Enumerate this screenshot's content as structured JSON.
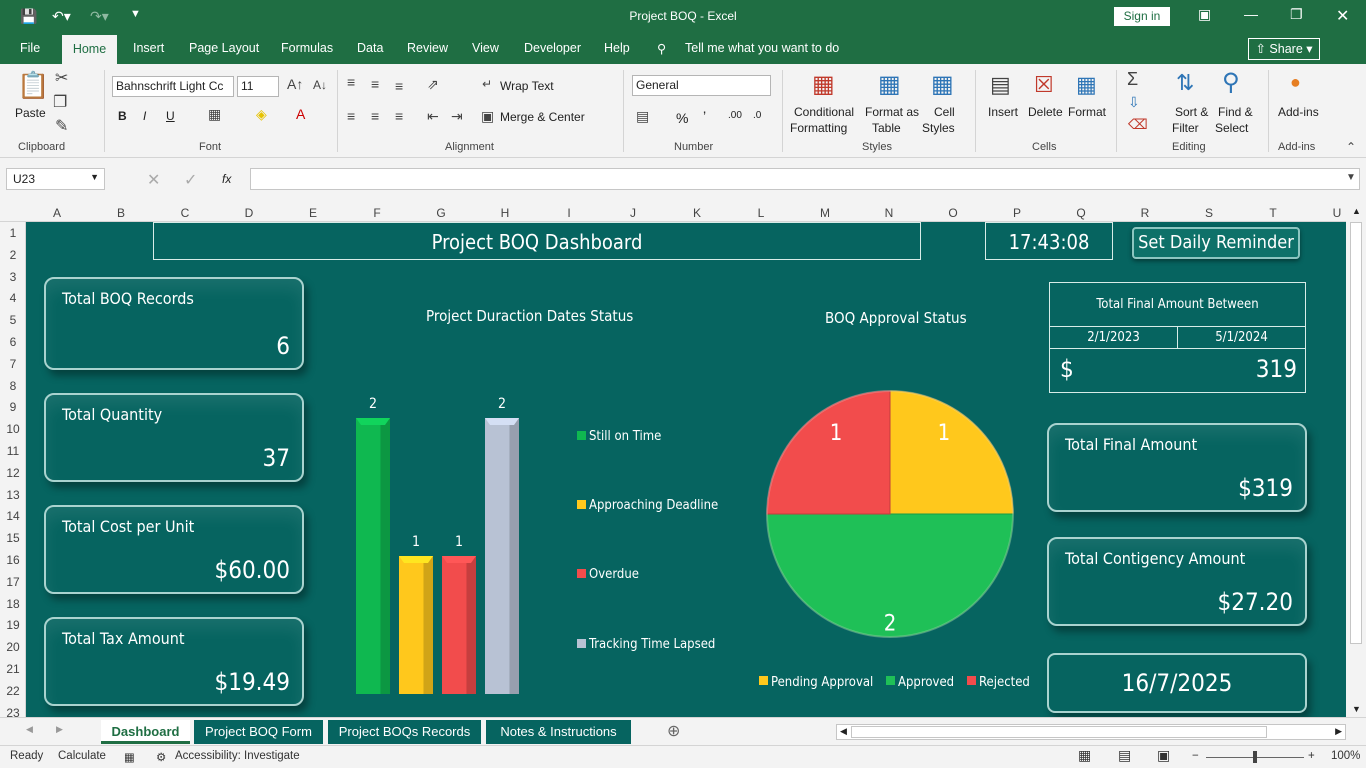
{
  "window": {
    "title": "Project BOQ  -  Excel",
    "sign_in": "Sign in"
  },
  "menu": {
    "file": "File",
    "home": "Home",
    "insert": "Insert",
    "page_layout": "Page Layout",
    "formulas": "Formulas",
    "data": "Data",
    "review": "Review",
    "view": "View",
    "developer": "Developer",
    "help": "Help",
    "tell_me": "Tell me what you want to do",
    "share": "Share"
  },
  "ribbon": {
    "paste": "Paste",
    "clipboard": "Clipboard",
    "font_name": "Bahnschrift Light Cc",
    "font_size": "11",
    "font": "Font",
    "wrap_text": "Wrap Text",
    "merge_center": "Merge & Center",
    "alignment": "Alignment",
    "number_format": "General",
    "number": "Number",
    "conditional": "Conditional",
    "formatting": "Formatting",
    "format_as": "Format as",
    "table": "Table",
    "cell": "Cell",
    "styles_btn": "Styles",
    "styles": "Styles",
    "insert": "Insert",
    "delete": "Delete",
    "format": "Format",
    "cells": "Cells",
    "sort": "Sort &",
    "filter": "Filter",
    "find": "Find &",
    "select": "Select",
    "editing": "Editing",
    "addins": "Add-ins",
    "addins_group": "Add-ins"
  },
  "formula_bar": {
    "name_box": "U23",
    "fx": "fx",
    "formula": ""
  },
  "columns": [
    "A",
    "B",
    "C",
    "D",
    "E",
    "F",
    "G",
    "H",
    "I",
    "J",
    "K",
    "L",
    "M",
    "N",
    "O",
    "P",
    "Q",
    "R",
    "S",
    "T",
    "U"
  ],
  "rows": [
    "1",
    "2",
    "3",
    "4",
    "5",
    "6",
    "7",
    "8",
    "9",
    "10",
    "11",
    "12",
    "13",
    "14",
    "15",
    "16",
    "17",
    "18",
    "19",
    "20",
    "21",
    "22",
    "23"
  ],
  "dashboard": {
    "title": "Project BOQ Dashboard",
    "time": "17:43:08",
    "reminder": "Set Daily Reminder",
    "kpis_left": [
      {
        "label": "Total BOQ Records",
        "value": "6"
      },
      {
        "label": "Total Quantity",
        "value": "37"
      },
      {
        "label": "Total Cost per Unit",
        "value": "$60.00"
      },
      {
        "label": "Total Tax Amount",
        "value": "$19.49"
      }
    ],
    "between": {
      "title": "Total Final Amount Between",
      "start": "2/1/2023",
      "end": "5/1/2024",
      "currency": "$",
      "value": "319"
    },
    "kpis_right": [
      {
        "label": "Total Final Amount",
        "value": "$319"
      },
      {
        "label": "Total Contigency Amount",
        "value": "$27.20"
      }
    ],
    "date": "16/7/2025"
  },
  "chart_data": [
    {
      "type": "bar",
      "title": "Project Duraction Dates Status",
      "categories": [
        "Still on Time",
        "Approaching Deadline",
        "Overdue",
        "Tracking Time Lapsed"
      ],
      "values": [
        2,
        1,
        1,
        2
      ],
      "labels": [
        "2",
        "1",
        "1",
        "2"
      ],
      "colors": [
        "#0fb850",
        "#ffc81c",
        "#f24c4c",
        "#b8c2d4"
      ],
      "ylim": [
        0,
        2
      ],
      "legend": "right",
      "grid": false
    },
    {
      "type": "pie",
      "title": "BOQ Approval Status",
      "categories": [
        "Pending Approval",
        "Approved",
        "Rejected"
      ],
      "values": [
        1,
        2,
        1
      ],
      "labels": [
        "1",
        "2",
        "1"
      ],
      "colors": [
        "#ffc81c",
        "#1fc057",
        "#f24c4c"
      ],
      "legend": "bottom"
    }
  ],
  "tabs": [
    "Dashboard",
    "Project BOQ Form",
    "Project BOQs Records",
    "Notes & Instructions"
  ],
  "status": {
    "ready": "Ready",
    "calculate": "Calculate",
    "accessibility": "Accessibility: Investigate",
    "zoom": "100%"
  }
}
